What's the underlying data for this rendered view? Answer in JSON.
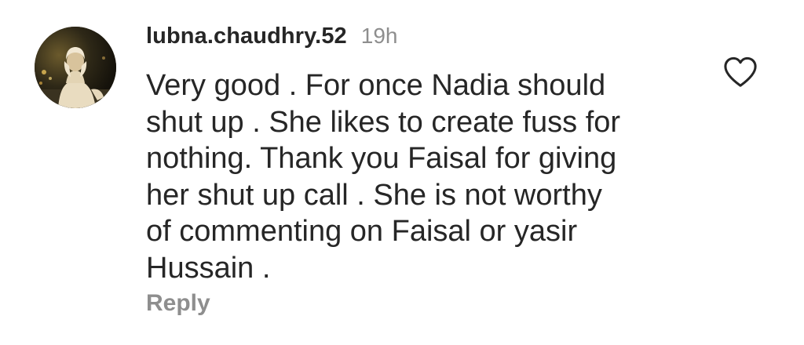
{
  "comment": {
    "username": "lubna.chaudhry.52",
    "timestamp": "19h",
    "text_lines": [
      "Very good . For once Nadia should",
      "shut up . She likes to create fuss for",
      "nothing. Thank you Faisal for giving",
      "her shut up call . She is not worthy",
      "of commenting on Faisal or yasir",
      "Hussain ."
    ],
    "reply_label": "Reply",
    "avatar": "user-avatar-photo",
    "like_icon": "heart-outline-icon"
  },
  "colors": {
    "text_primary": "#262626",
    "text_secondary": "#8e8e8e",
    "background": "#ffffff"
  }
}
